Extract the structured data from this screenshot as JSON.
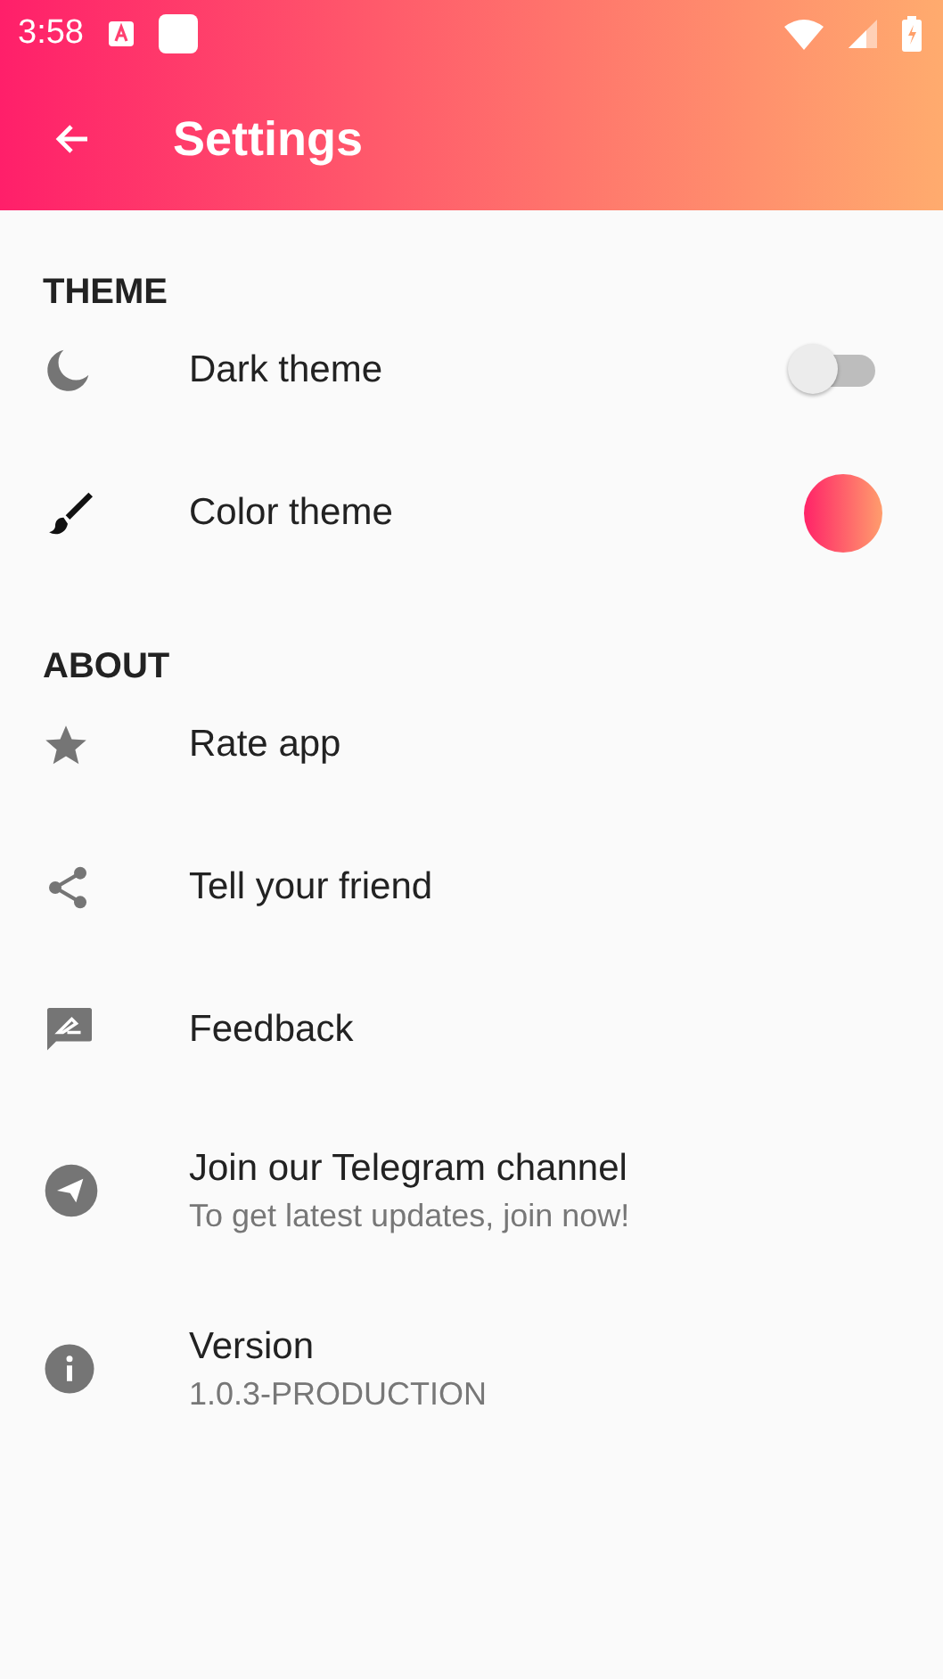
{
  "status_bar": {
    "time": "3:58"
  },
  "app_bar": {
    "title": "Settings"
  },
  "sections": [
    {
      "title": "THEME",
      "items": [
        {
          "kind": "toggle",
          "label": "Dark theme",
          "on": false
        },
        {
          "kind": "swatch",
          "label": "Color theme"
        }
      ]
    },
    {
      "title": "ABOUT",
      "items": [
        {
          "kind": "plain",
          "label": "Rate app"
        },
        {
          "kind": "plain",
          "label": "Tell your friend"
        },
        {
          "kind": "plain",
          "label": "Feedback"
        },
        {
          "kind": "plain",
          "label": "Join our Telegram channel",
          "subtitle": "To get latest updates, join now!"
        },
        {
          "kind": "plain",
          "label": "Version",
          "subtitle": "1.0.3-PRODUCTION"
        }
      ]
    }
  ]
}
